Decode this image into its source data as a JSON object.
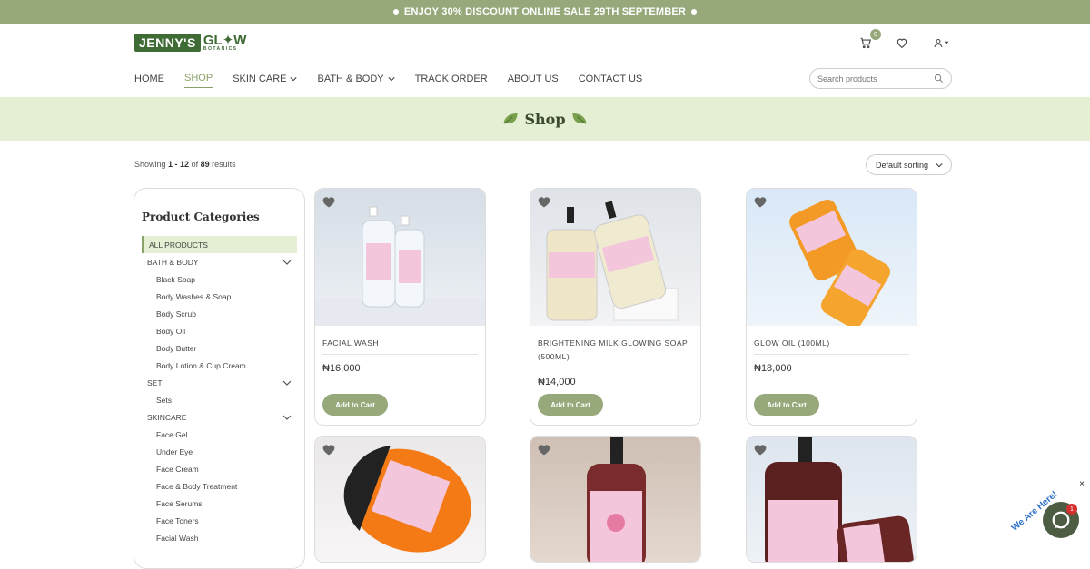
{
  "announcement": "ENJOY 30% DISCOUNT ONLINE SALE 29TH SEPTEMBER",
  "logo": {
    "main": "JENNY'S",
    "glow": "GL✦W",
    "sub": "BOTANICS"
  },
  "cart_count": "0",
  "nav": [
    {
      "label": "HOME"
    },
    {
      "label": "SHOP"
    },
    {
      "label": "SKIN CARE"
    },
    {
      "label": "BATH & BODY"
    },
    {
      "label": "TRACK ORDER"
    },
    {
      "label": "ABOUT US"
    },
    {
      "label": "CONTACT US"
    }
  ],
  "search": {
    "placeholder": "Search products"
  },
  "banner": {
    "title": "Shop"
  },
  "results": {
    "prefix": "Showing",
    "range": "1 - 12",
    "of": "of",
    "total": "89",
    "suffix": "results"
  },
  "sort": {
    "selected": "Default sorting"
  },
  "sidebar": {
    "title": "Product Categories",
    "categories": [
      {
        "label": "ALL PRODUCTS"
      },
      {
        "label": "BATH & BODY"
      },
      {
        "label": "Black Soap"
      },
      {
        "label": "Body Washes & Soap"
      },
      {
        "label": "Body Scrub"
      },
      {
        "label": "Body Oil"
      },
      {
        "label": "Body Butter"
      },
      {
        "label": "Body Lotion & Cup Cream"
      },
      {
        "label": "SET"
      },
      {
        "label": "Sets"
      },
      {
        "label": "SKINCARE"
      },
      {
        "label": "Face Gel"
      },
      {
        "label": "Under Eye"
      },
      {
        "label": "Face Cream"
      },
      {
        "label": "Face & Body Treatment"
      },
      {
        "label": "Face Serums"
      },
      {
        "label": "Face Toners"
      },
      {
        "label": "Facial Wash"
      }
    ]
  },
  "products": [
    {
      "name": "FACIAL WASH",
      "price": "₦16,000",
      "button": "Add to Cart"
    },
    {
      "name": "BRIGHTENING MILK GLOWING SOAP (500ML)",
      "price": "₦14,000",
      "button": "Add to Cart"
    },
    {
      "name": "GLOW OIL (100ML)",
      "price": "₦18,000",
      "button": "Add to Cart"
    }
  ],
  "chat": {
    "label": "We Are Here!",
    "badge": "1",
    "close": "×"
  },
  "colors": {
    "accent": "#97a97b",
    "brand": "#3f6b35",
    "banner": "#e4efd3"
  }
}
